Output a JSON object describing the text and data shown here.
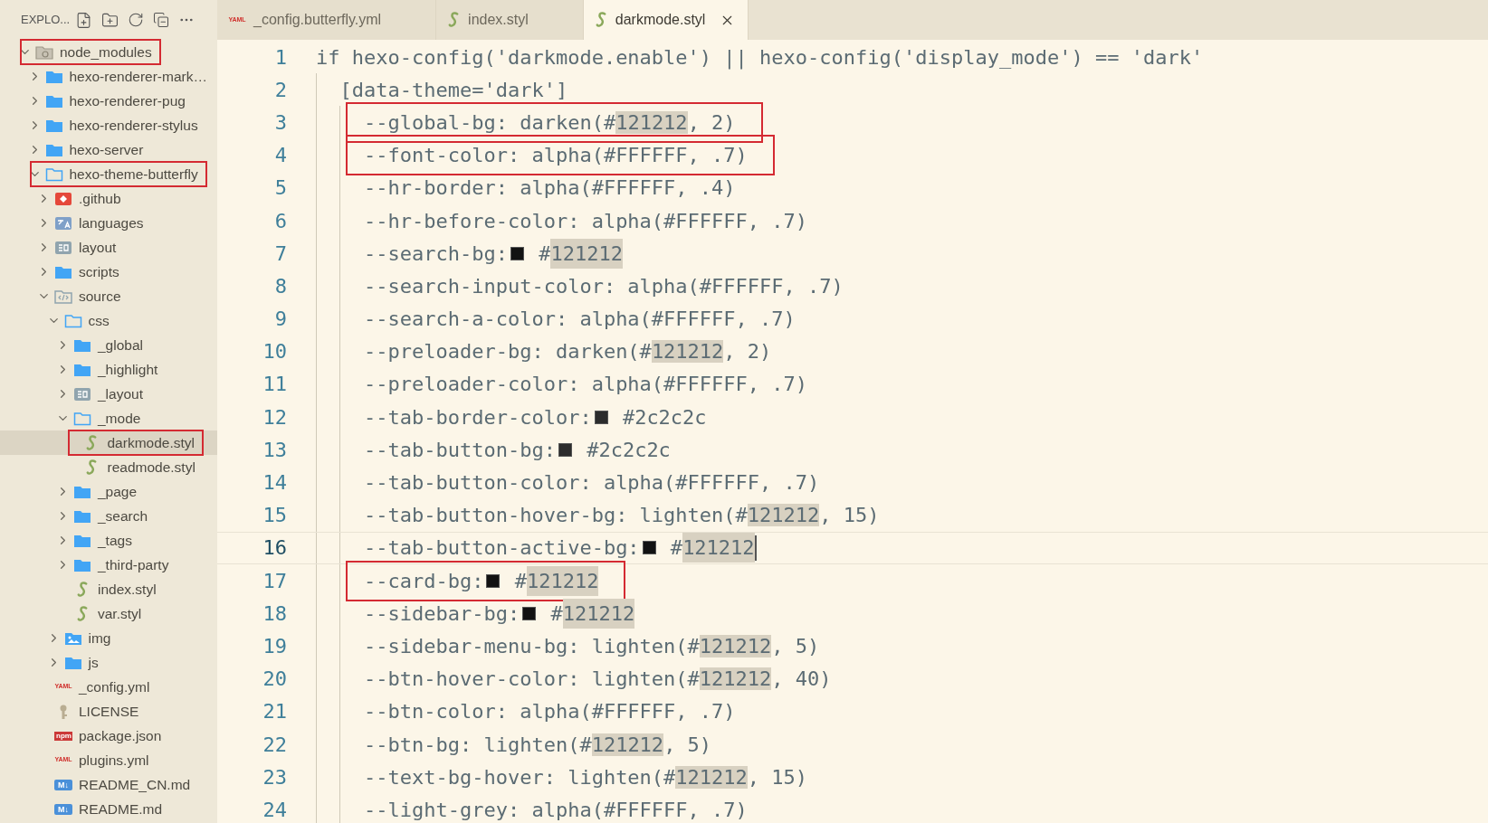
{
  "explorer": {
    "title": "EXPLO...",
    "tree": [
      {
        "label": "node_modules",
        "kind": "node-folder",
        "expanded": true,
        "selected": false,
        "boxed": true,
        "children": [
          {
            "label": "hexo-renderer-mark…",
            "kind": "folder",
            "expanded": false,
            "selected": false,
            "boxed": false
          },
          {
            "label": "hexo-renderer-pug",
            "kind": "folder",
            "expanded": false,
            "selected": false,
            "boxed": false
          },
          {
            "label": "hexo-renderer-stylus",
            "kind": "folder",
            "expanded": false,
            "selected": false,
            "boxed": false
          },
          {
            "label": "hexo-server",
            "kind": "folder",
            "expanded": false,
            "selected": false,
            "boxed": false
          },
          {
            "label": "hexo-theme-butterfly",
            "kind": "folder",
            "expanded": true,
            "selected": false,
            "boxed": true,
            "children": [
              {
                "label": ".github",
                "kind": "git-folder",
                "expanded": false,
                "selected": false,
                "boxed": false
              },
              {
                "label": "languages",
                "kind": "lang-folder",
                "expanded": false,
                "selected": false,
                "boxed": false
              },
              {
                "label": "layout",
                "kind": "layout-folder",
                "expanded": false,
                "selected": false,
                "boxed": false
              },
              {
                "label": "scripts",
                "kind": "folder",
                "expanded": false,
                "selected": false,
                "boxed": false
              },
              {
                "label": "source",
                "kind": "code-folder",
                "expanded": true,
                "selected": false,
                "boxed": false,
                "children": [
                  {
                    "label": "css",
                    "kind": "folder",
                    "expanded": true,
                    "selected": false,
                    "boxed": false,
                    "children": [
                      {
                        "label": "_global",
                        "kind": "folder",
                        "expanded": false,
                        "selected": false,
                        "boxed": false
                      },
                      {
                        "label": "_highlight",
                        "kind": "folder",
                        "expanded": false,
                        "selected": false,
                        "boxed": false
                      },
                      {
                        "label": "_layout",
                        "kind": "layout-folder",
                        "expanded": false,
                        "selected": false,
                        "boxed": false
                      },
                      {
                        "label": "_mode",
                        "kind": "folder",
                        "expanded": true,
                        "selected": false,
                        "boxed": false,
                        "children": [
                          {
                            "label": "darkmode.styl",
                            "kind": "styl",
                            "selected": true,
                            "boxed": true
                          },
                          {
                            "label": "readmode.styl",
                            "kind": "styl",
                            "selected": false,
                            "boxed": false
                          }
                        ]
                      },
                      {
                        "label": "_page",
                        "kind": "folder",
                        "expanded": false,
                        "selected": false,
                        "boxed": false
                      },
                      {
                        "label": "_search",
                        "kind": "folder",
                        "expanded": false,
                        "selected": false,
                        "boxed": false
                      },
                      {
                        "label": "_tags",
                        "kind": "folder",
                        "expanded": false,
                        "selected": false,
                        "boxed": false
                      },
                      {
                        "label": "_third-party",
                        "kind": "folder",
                        "expanded": false,
                        "selected": false,
                        "boxed": false
                      },
                      {
                        "label": "index.styl",
                        "kind": "styl",
                        "selected": false,
                        "boxed": false
                      },
                      {
                        "label": "var.styl",
                        "kind": "styl",
                        "selected": false,
                        "boxed": false
                      }
                    ]
                  },
                  {
                    "label": "img",
                    "kind": "image-folder",
                    "expanded": false,
                    "selected": false,
                    "boxed": false
                  },
                  {
                    "label": "js",
                    "kind": "folder",
                    "expanded": false,
                    "selected": false,
                    "boxed": false
                  }
                ]
              },
              {
                "label": "_config.yml",
                "kind": "yaml",
                "badge": "YAML",
                "selected": false,
                "boxed": false
              },
              {
                "label": "LICENSE",
                "kind": "license",
                "selected": false,
                "boxed": false
              },
              {
                "label": "package.json",
                "kind": "npm",
                "badge": "npm",
                "selected": false,
                "boxed": false
              },
              {
                "label": "plugins.yml",
                "kind": "yaml",
                "badge": "YAML",
                "selected": false,
                "boxed": false
              },
              {
                "label": "README_CN.md",
                "kind": "md",
                "badge": "M↓",
                "selected": false,
                "boxed": false
              },
              {
                "label": "README.md",
                "kind": "md",
                "badge": "M↓",
                "selected": false,
                "boxed": false
              }
            ]
          }
        ]
      }
    ]
  },
  "tabs": [
    {
      "label": "_config.butterfly.yml",
      "kind": "yaml",
      "badge": "YAML",
      "selected": false
    },
    {
      "label": "index.styl",
      "kind": "styl",
      "selected": false
    },
    {
      "label": "darkmode.styl",
      "kind": "styl",
      "selected": true
    }
  ],
  "editor": {
    "lines": [
      {
        "number": "1",
        "current": false,
        "boxed": false,
        "parts": [
          {
            "kind": "text",
            "text": "if hexo-config('darkmode.enable') || hexo-config('display_mode') == 'dark'"
          }
        ]
      },
      {
        "number": "2",
        "current": false,
        "boxed": false,
        "parts": [
          {
            "kind": "text",
            "text": "  [data-theme='dark']"
          }
        ]
      },
      {
        "number": "3",
        "current": false,
        "boxed": true,
        "parts": [
          {
            "kind": "text",
            "text": "    --global-bg: darken(#"
          },
          {
            "kind": "match",
            "text": "121212"
          },
          {
            "kind": "text",
            "text": ", 2)"
          }
        ]
      },
      {
        "number": "4",
        "current": false,
        "boxed": true,
        "parts": [
          {
            "kind": "text",
            "text": "    --font-color: alpha(#FFFFFF, .7)"
          }
        ]
      },
      {
        "number": "5",
        "current": false,
        "boxed": false,
        "parts": [
          {
            "kind": "text",
            "text": "    --hr-border: alpha(#FFFFFF, .4)"
          }
        ]
      },
      {
        "number": "6",
        "current": false,
        "boxed": false,
        "parts": [
          {
            "kind": "text",
            "text": "    --hr-before-color: alpha(#FFFFFF, .7)"
          }
        ]
      },
      {
        "number": "7",
        "current": false,
        "boxed": false,
        "parts": [
          {
            "kind": "text",
            "text": "    --search-bg:"
          },
          {
            "kind": "swatch",
            "color": "#121212"
          },
          {
            "kind": "text",
            "text": " #"
          },
          {
            "kind": "match",
            "text": "121212"
          }
        ]
      },
      {
        "number": "8",
        "current": false,
        "boxed": false,
        "parts": [
          {
            "kind": "text",
            "text": "    --search-input-color: alpha(#FFFFFF, .7)"
          }
        ]
      },
      {
        "number": "9",
        "current": false,
        "boxed": false,
        "parts": [
          {
            "kind": "text",
            "text": "    --search-a-color: alpha(#FFFFFF, .7)"
          }
        ]
      },
      {
        "number": "10",
        "current": false,
        "boxed": false,
        "parts": [
          {
            "kind": "text",
            "text": "    --preloader-bg: darken(#"
          },
          {
            "kind": "match",
            "text": "121212"
          },
          {
            "kind": "text",
            "text": ", 2)"
          }
        ]
      },
      {
        "number": "11",
        "current": false,
        "boxed": false,
        "parts": [
          {
            "kind": "text",
            "text": "    --preloader-color: alpha(#FFFFFF, .7)"
          }
        ]
      },
      {
        "number": "12",
        "current": false,
        "boxed": false,
        "parts": [
          {
            "kind": "text",
            "text": "    --tab-border-color:"
          },
          {
            "kind": "swatch",
            "color": "#2c2c2c"
          },
          {
            "kind": "text",
            "text": " #2c2c2c"
          }
        ]
      },
      {
        "number": "13",
        "current": false,
        "boxed": false,
        "parts": [
          {
            "kind": "text",
            "text": "    --tab-button-bg:"
          },
          {
            "kind": "swatch",
            "color": "#2c2c2c"
          },
          {
            "kind": "text",
            "text": " #2c2c2c"
          }
        ]
      },
      {
        "number": "14",
        "current": false,
        "boxed": false,
        "parts": [
          {
            "kind": "text",
            "text": "    --tab-button-color: alpha(#FFFFFF, .7)"
          }
        ]
      },
      {
        "number": "15",
        "current": false,
        "boxed": false,
        "parts": [
          {
            "kind": "text",
            "text": "    --tab-button-hover-bg: lighten(#"
          },
          {
            "kind": "match",
            "text": "121212"
          },
          {
            "kind": "text",
            "text": ", 15)"
          }
        ]
      },
      {
        "number": "16",
        "current": true,
        "boxed": false,
        "parts": [
          {
            "kind": "text",
            "text": "    --tab-button-active-bg:"
          },
          {
            "kind": "swatch",
            "color": "#121212"
          },
          {
            "kind": "text",
            "text": " #"
          },
          {
            "kind": "match",
            "text": "121212"
          }
        ]
      },
      {
        "number": "17",
        "current": false,
        "boxed": true,
        "parts": [
          {
            "kind": "text",
            "text": "    --card-bg:"
          },
          {
            "kind": "swatch",
            "color": "#121212"
          },
          {
            "kind": "text",
            "text": " #"
          },
          {
            "kind": "match",
            "text": "121212"
          }
        ]
      },
      {
        "number": "18",
        "current": false,
        "boxed": false,
        "parts": [
          {
            "kind": "text",
            "text": "    --sidebar-bg:"
          },
          {
            "kind": "swatch",
            "color": "#121212"
          },
          {
            "kind": "text",
            "text": " #"
          },
          {
            "kind": "match",
            "text": "121212"
          }
        ]
      },
      {
        "number": "19",
        "current": false,
        "boxed": false,
        "parts": [
          {
            "kind": "text",
            "text": "    --sidebar-menu-bg: lighten(#"
          },
          {
            "kind": "match",
            "text": "121212"
          },
          {
            "kind": "text",
            "text": ", 5)"
          }
        ]
      },
      {
        "number": "20",
        "current": false,
        "boxed": false,
        "parts": [
          {
            "kind": "text",
            "text": "    --btn-hover-color: lighten(#"
          },
          {
            "kind": "match",
            "text": "121212"
          },
          {
            "kind": "text",
            "text": ", 40)"
          }
        ]
      },
      {
        "number": "21",
        "current": false,
        "boxed": false,
        "parts": [
          {
            "kind": "text",
            "text": "    --btn-color: alpha(#FFFFFF, .7)"
          }
        ]
      },
      {
        "number": "22",
        "current": false,
        "boxed": false,
        "parts": [
          {
            "kind": "text",
            "text": "    --btn-bg: lighten(#"
          },
          {
            "kind": "match",
            "text": "121212"
          },
          {
            "kind": "text",
            "text": ", 5)"
          }
        ]
      },
      {
        "number": "23",
        "current": false,
        "boxed": false,
        "parts": [
          {
            "kind": "text",
            "text": "    --text-bg-hover: lighten(#"
          },
          {
            "kind": "match",
            "text": "121212"
          },
          {
            "kind": "text",
            "text": ", 15)"
          }
        ]
      },
      {
        "number": "24",
        "current": false,
        "boxed": false,
        "parts": [
          {
            "kind": "text",
            "text": "    --light-grey: alpha(#FFFFFF, .7)"
          }
        ]
      }
    ]
  }
}
